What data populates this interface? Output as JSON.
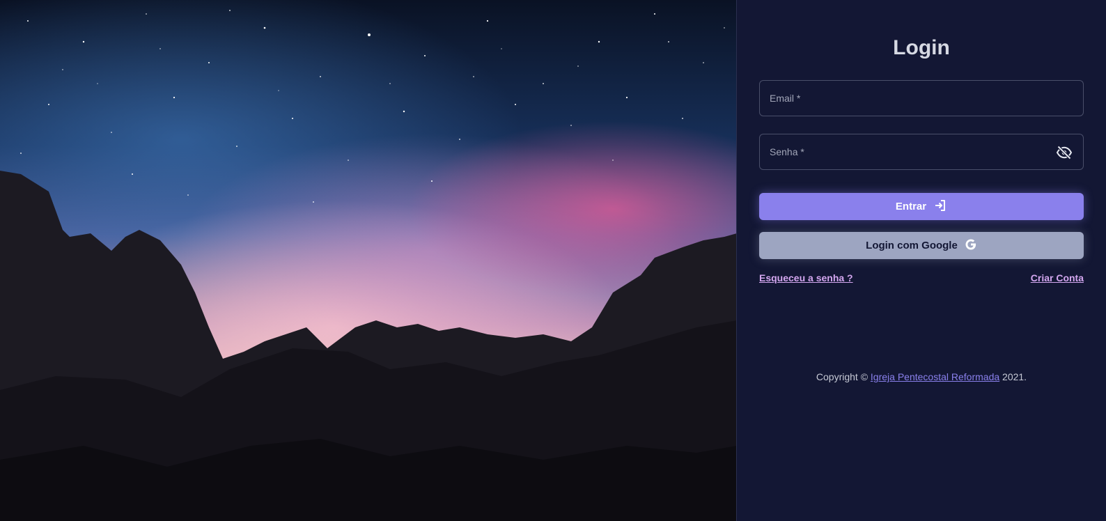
{
  "hero": {
    "description_icon": "night-sky-rocks-photo"
  },
  "login": {
    "title": "Login",
    "email_placeholder": "Email *",
    "password_placeholder": "Senha *",
    "password_toggle_icon": "eye-off-icon",
    "enter_label": "Entrar",
    "enter_icon": "login-arrow-icon",
    "google_label": "Login com Google",
    "google_icon": "google-g-icon",
    "forgot_label": "Esqueceu a senha ?",
    "create_label": "Criar Conta"
  },
  "footer": {
    "prefix": "Copyright ©",
    "org": "Igreja Pentecostal Reformada",
    "year": "2021."
  },
  "colors": {
    "panel_bg": "#131734",
    "primary": "#8a80ec",
    "secondary": "#9da5c1",
    "link": "#d4a7f0"
  }
}
